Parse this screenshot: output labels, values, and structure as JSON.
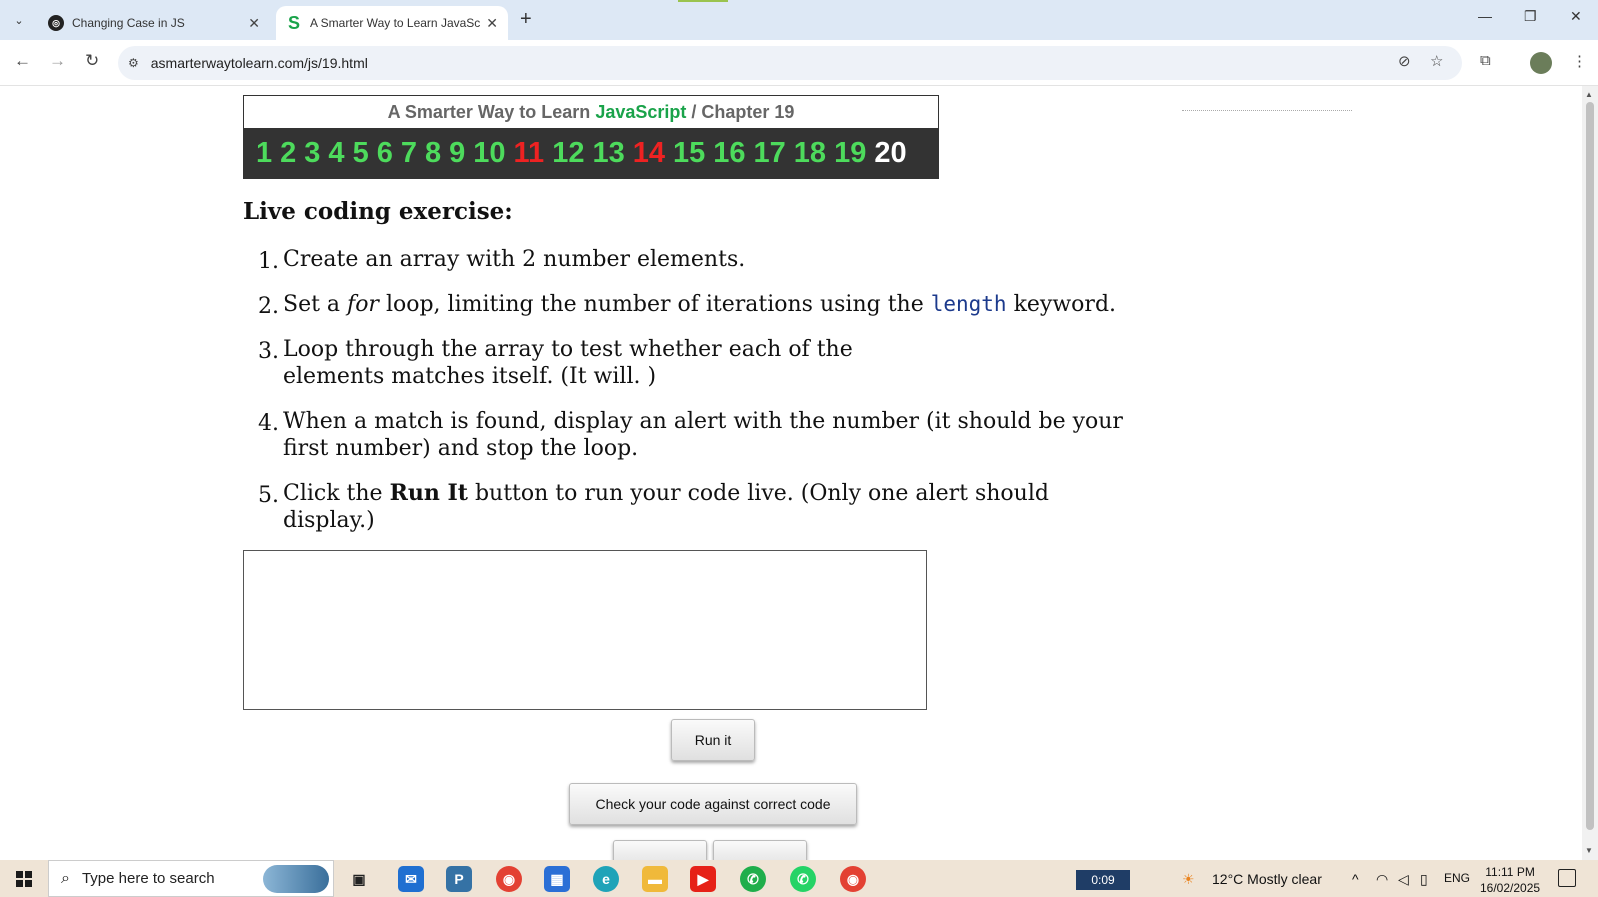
{
  "browser": {
    "tabs": [
      {
        "title": "Changing Case in JS",
        "favicon": "chatgpt-icon"
      },
      {
        "title": "A Smarter Way to Learn JavaSc",
        "favicon": "s-icon"
      }
    ],
    "url": "asmarterwaytolearn.com/js/19.html"
  },
  "page": {
    "header": {
      "prefix": "A Smarter Way to Learn",
      "brand": "JavaScript",
      "suffix": "/  Chapter 19"
    },
    "chapters": [
      "1",
      "2",
      "3",
      "4",
      "5",
      "6",
      "7",
      "8",
      "9",
      "10",
      "11",
      "12",
      "13",
      "14",
      "15",
      "16",
      "17",
      "18",
      "19",
      "20"
    ],
    "exercise_title": "Live coding exercise:",
    "steps": {
      "s1": {
        "num": "1.",
        "text": "Create an array with 2 number elements."
      },
      "s2": {
        "num": "2.",
        "pre": "Set a ",
        "em": "for",
        "mid": " loop, limiting the number of iterations using the ",
        "code": "length",
        "post": " keyword."
      },
      "s3": {
        "num": "3.",
        "text": "Loop through the array to test whether each of the elements matches itself. (It will. )"
      },
      "s4": {
        "num": "4.",
        "text": "When a match is found, display an alert with the number (it should be your first number) and stop the loop."
      },
      "s5": {
        "num": "5.",
        "pre": "Click the ",
        "bold": "Run It",
        "post": " button to run your code live. (Only one alert should display.)"
      }
    },
    "run_button": "Run it",
    "check_button": "Check your code against correct code",
    "code_value": ""
  },
  "taskbar": {
    "search_placeholder": "Type here to search",
    "timer": "0:09",
    "weather": "12°C  Mostly clear",
    "language": "ENG",
    "time": "11:11 PM",
    "date": "16/02/2025"
  }
}
